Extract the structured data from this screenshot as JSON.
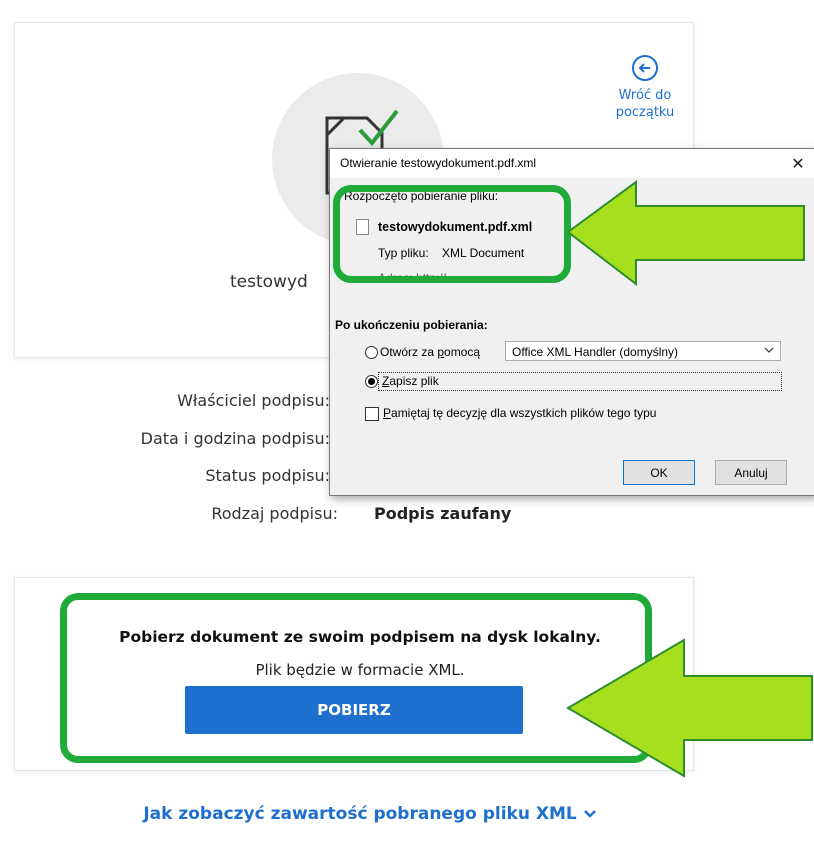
{
  "top_card": {
    "back_link": {
      "line1": "Wróć do",
      "line2": "początku"
    },
    "file_name_partial": "testowyd"
  },
  "signature": {
    "owner_label": "Właściciel podpisu:",
    "date_label": "Data i godzina podpisu:",
    "status_label": "Status podpisu:",
    "type_label": "Rodzaj podpisu:",
    "type_value": "Podpis zaufany"
  },
  "download": {
    "title": "Pobierz dokument ze swoim podpisem na dysk lokalny.",
    "subtitle": "Plik będzie w formacie XML.",
    "button_label": "POBIERZ",
    "help_link": "Jak zobaczyć zawartość pobranego pliku XML"
  },
  "dialog": {
    "title": "Otwieranie testowydokument.pdf.xml",
    "started": "Rozpoczęto pobieranie pliku:",
    "filename": "testowydokument.pdf.xml",
    "type_label": "Typ pliku:",
    "type_value": "XML Document",
    "address_partial": "Adres: http://...",
    "after_label": "Po ukończeniu pobierania:",
    "open_with_pre": "Otwórz za ",
    "open_with_u": "p",
    "open_with_post": "omocą",
    "app_value": "Office XML Handler (domyślny)",
    "save_u": "Z",
    "save_post": "apisz plik",
    "remember_u": "P",
    "remember_post": "amiętaj tę decyzję dla wszystkich plików tego typu",
    "ok_label": "OK",
    "cancel_label": "Anuluj"
  },
  "colors": {
    "accent": "#1e6fce",
    "highlight_green": "#1faa3a",
    "arrow_green": "#a6df1e"
  }
}
